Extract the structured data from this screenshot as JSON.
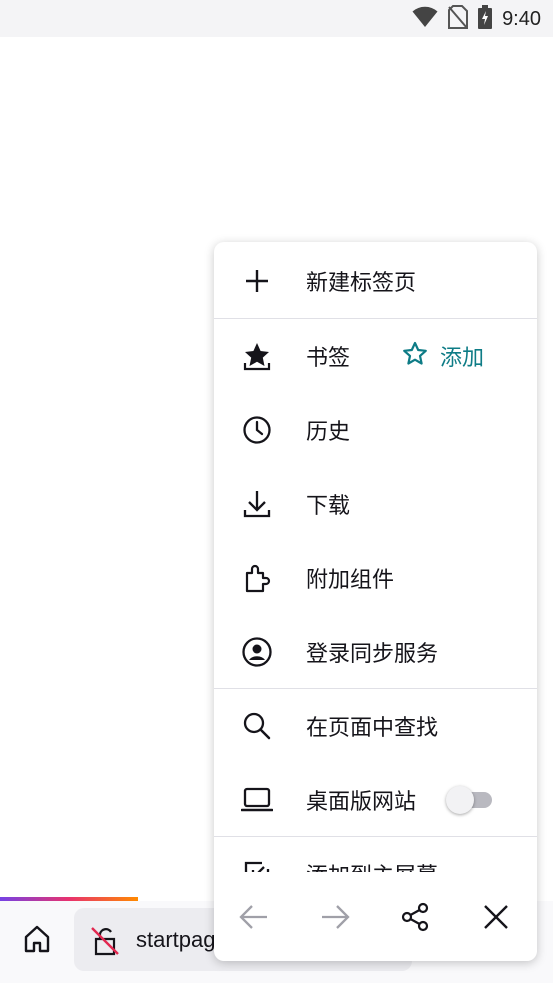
{
  "status_bar": {
    "time": "9:40",
    "icons": [
      "wifi-icon",
      "no-sim-icon",
      "battery-charging-icon"
    ]
  },
  "toolbar": {
    "home_icon": "home-icon",
    "url_text": "startpage",
    "lock_icon": "insecure-lock-icon"
  },
  "menu": {
    "items": [
      {
        "label": "新建标签页",
        "icon": "plus-icon"
      },
      {
        "label": "书签",
        "icon": "bookmark-star-icon",
        "add_label": "添加",
        "add_icon": "star-outline-icon"
      },
      {
        "label": "历史",
        "icon": "clock-icon"
      },
      {
        "label": "下载",
        "icon": "download-icon"
      },
      {
        "label": "附加组件",
        "icon": "puzzle-icon"
      },
      {
        "label": "登录同步服务",
        "icon": "account-icon"
      },
      {
        "label": "在页面中查找",
        "icon": "search-icon"
      },
      {
        "label": "桌面版网站",
        "icon": "laptop-icon",
        "toggle_on": false
      },
      {
        "label": "添加到主屏幕",
        "icon": "add-to-home-icon"
      }
    ],
    "nav": [
      "back-arrow-icon",
      "forward-arrow-icon",
      "share-icon",
      "close-icon"
    ]
  },
  "colors": {
    "accent": "#0e7c86",
    "text": "#15141a",
    "toolbar_bg": "#f9f9fb",
    "urlbar_bg": "#ececf0"
  }
}
